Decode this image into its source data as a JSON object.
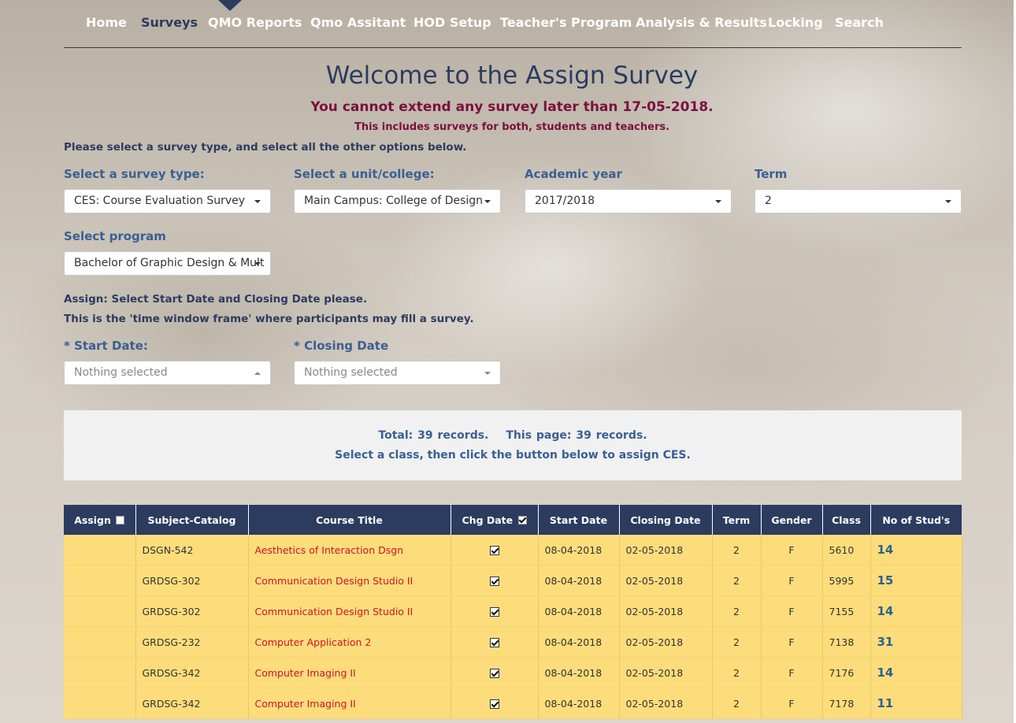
{
  "nav": {
    "items": [
      {
        "label": "Home",
        "active": false
      },
      {
        "label": "Surveys",
        "active": true
      },
      {
        "label": "QMO Reports",
        "active": false
      },
      {
        "label": "Qmo Assitant",
        "active": false
      },
      {
        "label": "HOD Setup",
        "active": false
      },
      {
        "label": "Teacher's Program",
        "active": false
      },
      {
        "label": "Analysis & Results",
        "active": false
      },
      {
        "label": "Locking",
        "active": false
      },
      {
        "label": "Search",
        "active": false
      }
    ]
  },
  "page": {
    "title": "Welcome to the Assign Survey",
    "warning": "You cannot extend any survey later than 17-05-2018.",
    "warning_sub": "This includes surveys for both, students and teachers.",
    "instruction": "Please select a survey type, and select all the other options below."
  },
  "filters": {
    "survey_type": {
      "label": "Select a survey type:",
      "value": "CES: Course Evaluation Survey"
    },
    "unit": {
      "label": "Select a unit/college:",
      "value": "Main Campus: College of Design"
    },
    "academic_year": {
      "label": "Academic year",
      "value": "2017/2018"
    },
    "term": {
      "label": "Term",
      "value": "2"
    },
    "program": {
      "label": "Select program",
      "value": "Bachelor of Graphic Design & Mult"
    }
  },
  "assign": {
    "line1": "Assign: Select Start Date and Closing Date please.",
    "line2": "This is the 'time window frame' where participants may fill a survey.",
    "start_label": "* Start Date:",
    "start_placeholder": "Nothing selected",
    "closing_label": "* Closing Date",
    "closing_placeholder": "Nothing selected"
  },
  "info": {
    "total": "Total: 39 records.",
    "this_page": "This page: 39 records.",
    "hint": "Select a class, then click the button below to assign CES."
  },
  "table": {
    "headers": [
      "Assign",
      "Subject-Catalog",
      "Course Title",
      "Chg Date",
      "Start Date",
      "Closing Date",
      "Term",
      "Gender",
      "Class",
      "No of Stud's"
    ],
    "rows": [
      {
        "subject": "DSGN-542",
        "title": "Aesthetics of Interaction Dsgn",
        "start": "08-04-2018",
        "closing": "02-05-2018",
        "term": "2",
        "gender": "F",
        "class": "5610",
        "studs": "14"
      },
      {
        "subject": "GRDSG-302",
        "title": "Communication Design Studio II",
        "start": "08-04-2018",
        "closing": "02-05-2018",
        "term": "2",
        "gender": "F",
        "class": "5995",
        "studs": "15"
      },
      {
        "subject": "GRDSG-302",
        "title": "Communication Design Studio II",
        "start": "08-04-2018",
        "closing": "02-05-2018",
        "term": "2",
        "gender": "F",
        "class": "7155",
        "studs": "14"
      },
      {
        "subject": "GRDSG-232",
        "title": "Computer Application 2",
        "start": "08-04-2018",
        "closing": "02-05-2018",
        "term": "2",
        "gender": "F",
        "class": "7138",
        "studs": "31"
      },
      {
        "subject": "GRDSG-342",
        "title": "Computer Imaging II",
        "start": "08-04-2018",
        "closing": "02-05-2018",
        "term": "2",
        "gender": "F",
        "class": "7176",
        "studs": "14"
      },
      {
        "subject": "GRDSG-342",
        "title": "Computer Imaging II",
        "start": "08-04-2018",
        "closing": "02-05-2018",
        "term": "2",
        "gender": "F",
        "class": "7178",
        "studs": "11"
      }
    ]
  },
  "colors": {
    "nav_active": "#2b3c5f",
    "warning": "#7b1040",
    "label": "#3a5f94",
    "table_header": "#2b3c5f",
    "row_bg": "#fddd7b",
    "course_link": "#d0102a"
  }
}
